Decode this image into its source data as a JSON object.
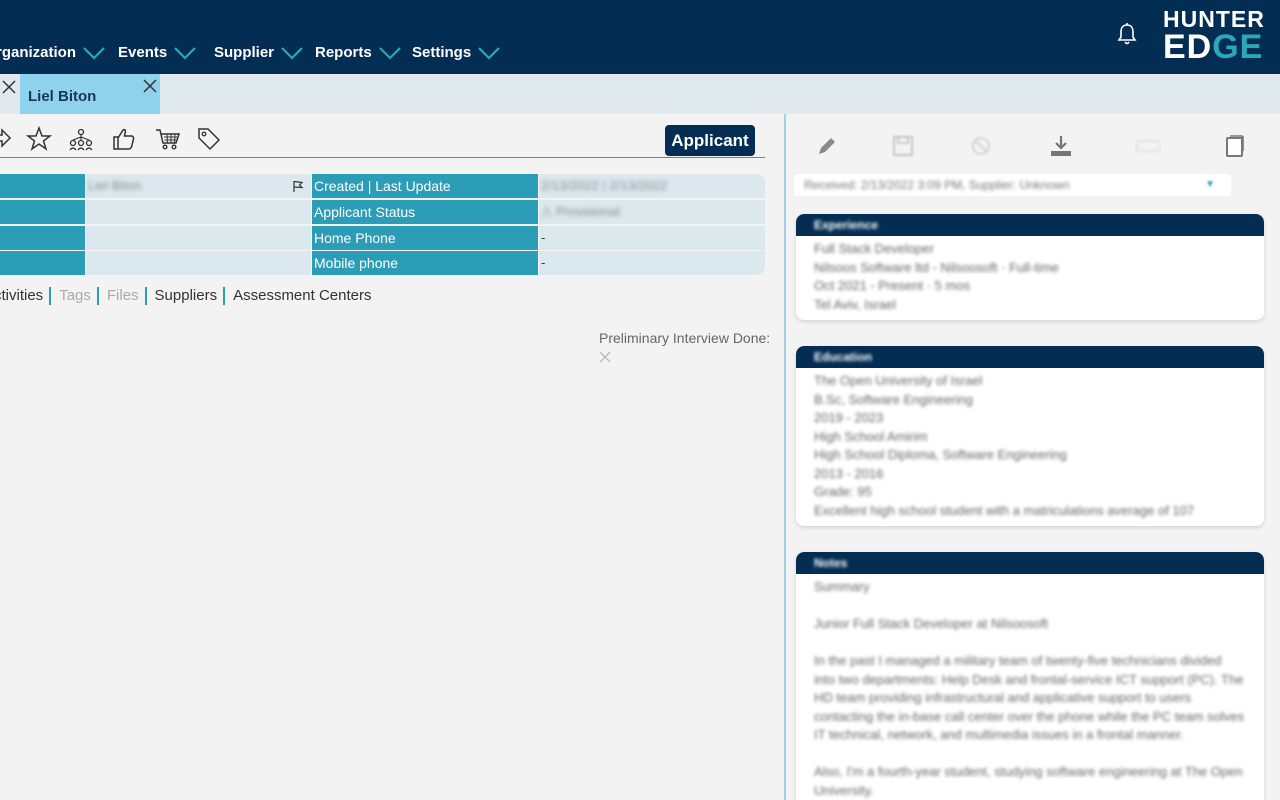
{
  "nav": {
    "items": [
      "rganization",
      "Events",
      "Supplier",
      "Reports",
      "Settings"
    ],
    "logo_top": "HUNTER",
    "logo_bottom_a": "ED",
    "logo_bottom_b": "GE"
  },
  "tabs": {
    "active_label": "Liel Biton"
  },
  "toolbar": {
    "applicant_label": "Applicant"
  },
  "grid": {
    "name_value": "Liel Biton",
    "created_label": "Created | Last Update",
    "created_value": "2/13/2022  |  2/13/2022",
    "status_label": "Applicant Status",
    "status_value": "Provisional",
    "home_phone_label": "Home Phone",
    "home_phone_value": "-",
    "mobile_label": "Mobile phone",
    "mobile_value": "-"
  },
  "subtabs": [
    "ctivities",
    "Tags",
    "Files",
    "Suppliers",
    "Assessment Centers"
  ],
  "prelim": {
    "label": "Preliminary Interview Done:"
  },
  "right": {
    "received": "Received: 2/13/2022 3:09 PM, Supplier: Unknown",
    "experience": {
      "title": "Experience",
      "lines": [
        "Full Stack Developer",
        "Nilsoos Software ltd - Nilsoosoft · Full-time",
        "Oct 2021 - Present · 5 mos",
        "Tel Aviv, Israel"
      ]
    },
    "education": {
      "title": "Education",
      "lines": [
        "The Open University of Israel",
        "B.Sc, Software Engineering",
        "2019 - 2023",
        "High School Amirim",
        "High School Diploma, Software Engineering",
        "2013 - 2016",
        "Grade: 95",
        "Excellent high school student with a matriculations average of 107"
      ]
    },
    "notes": {
      "title": "Notes",
      "summary": "Summary",
      "headline": "Junior Full Stack Developer at Nilsoosoft",
      "para1": "In the past I managed a military team of twenty-five technicians divided into two departments: Help Desk and frontal-service ICT support (PC). The HD team providing infrastructural and applicative support to users contacting the in-base call center over the phone while the PC team solves IT technical, network, and multimedia issues in a frontal manner.",
      "para2": "Also, I'm a fourth-year student, studying software engineering at The Open University."
    }
  }
}
